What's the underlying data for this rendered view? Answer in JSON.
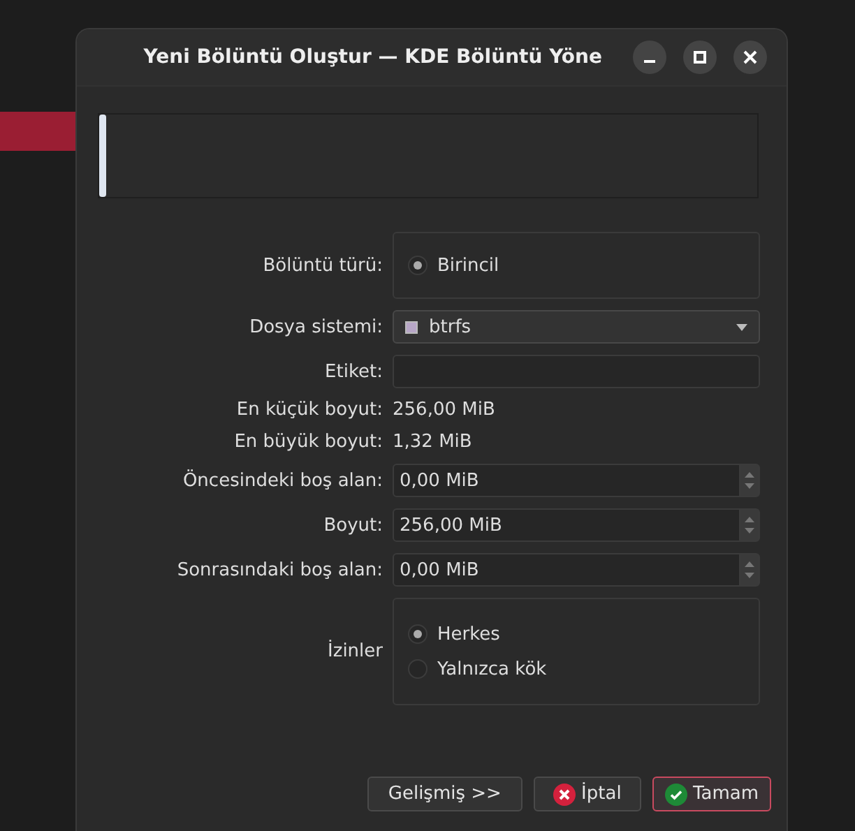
{
  "window": {
    "title": "Yeni Bölüntü Oluştur — KDE Bölüntü Yöne"
  },
  "form": {
    "rows": [
      {
        "kind": "radio_group",
        "label": "Bölüntü türü:",
        "options": [
          {
            "label": "Birincil",
            "selected": true
          }
        ]
      },
      {
        "kind": "combo",
        "label": "Dosya sistemi:",
        "value": "btrfs"
      },
      {
        "kind": "text",
        "label": "Etiket:"
      },
      {
        "kind": "info",
        "label": "En küçük boyut:",
        "value": "256,00 MiB"
      },
      {
        "kind": "info",
        "label": "En büyük boyut:",
        "value": "1,32 MiB"
      },
      {
        "kind": "spin",
        "label": "Öncesindeki boş alan:",
        "value": "0,00 MiB"
      },
      {
        "kind": "spin",
        "label": "Boyut:",
        "value": "256,00 MiB"
      },
      {
        "kind": "spin",
        "label": "Sonrasındaki boş alan:",
        "value": "0,00 MiB"
      },
      {
        "kind": "radio_group",
        "label": "İzinler",
        "options": [
          {
            "label": "Herkes",
            "selected": true
          },
          {
            "label": "Yalnızca kök",
            "selected": false
          }
        ]
      }
    ]
  },
  "buttons": [
    {
      "label": "Gelişmiş >>",
      "kind": "plain",
      "focused": false
    },
    {
      "label": "İptal",
      "kind": "cancel",
      "focused": false
    },
    {
      "label": "Tamam",
      "kind": "ok",
      "focused": true
    }
  ]
}
